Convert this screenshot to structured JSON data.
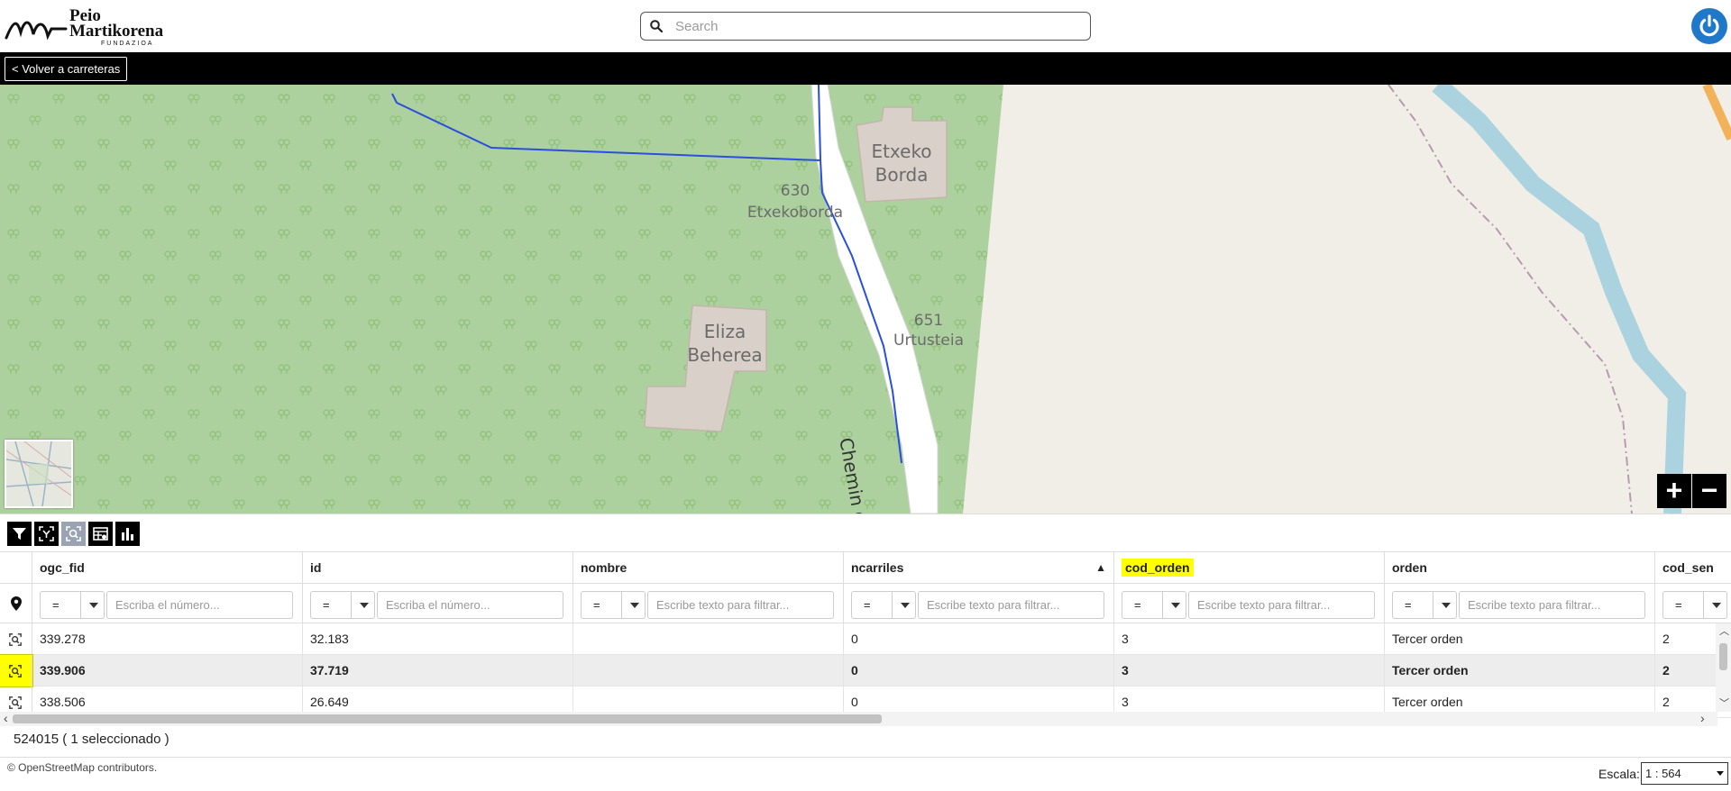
{
  "header": {
    "logo_line1": "Peio",
    "logo_line2": "Martikorena",
    "logo_line3": "FUNDAZIOA",
    "search_placeholder": "Search"
  },
  "topbar": {
    "back_label": "< Volver a carreteras"
  },
  "map": {
    "labels": {
      "etxeko_1": "Etxeko",
      "etxeko_2": "Borda",
      "addr_630_num": "630",
      "addr_630_name": "Etxekoborda",
      "eliza_1": "Eliza",
      "eliza_2": "Beherea",
      "addr_651_num": "651",
      "addr_651_name": "Urtusteia",
      "road_name": "Chemin des ve"
    },
    "zoom_in": "+",
    "zoom_out": "−"
  },
  "toolbar": {
    "buttons": [
      "filter-icon",
      "select-features-icon",
      "zoom-to-selection-icon",
      "table-settings-icon",
      "chart-icon"
    ]
  },
  "table": {
    "columns": [
      "ogc_fid",
      "id",
      "nombre",
      "ncarriles",
      "cod_orden",
      "orden",
      "cod_sen"
    ],
    "sorted_column": "ncarriles",
    "sort_indicator": "▲",
    "highlighted_column": "cod_orden",
    "operator": "=",
    "filter_placeholders": {
      "number": "Escriba el número...",
      "text": "Escribe texto para filtrar..."
    },
    "rows": [
      {
        "ogc_fid": "339.278",
        "id": "32.183",
        "nombre": "",
        "ncarriles": "0",
        "cod_orden": "3",
        "orden": "Tercer orden",
        "cod_sen": "2",
        "selected": false
      },
      {
        "ogc_fid": "339.906",
        "id": "37.719",
        "nombre": "",
        "ncarriles": "0",
        "cod_orden": "3",
        "orden": "Tercer orden",
        "cod_sen": "2",
        "selected": true
      },
      {
        "ogc_fid": "338.506",
        "id": "26.649",
        "nombre": "",
        "ncarriles": "0",
        "cod_orden": "3",
        "orden": "Tercer orden",
        "cod_sen": "2",
        "selected": false
      }
    ],
    "row_count_text": "524015 ( 1 seleccionado )"
  },
  "footer": {
    "attribution": "© OpenStreetMap contributors.",
    "scale_label": "Escala:",
    "scale_value": "1 : 564"
  },
  "colors": {
    "forest": "#add19e",
    "road_line": "#2a4fdc",
    "building": "#d9d0c9",
    "river": "#aad3df",
    "highlight": "#ffff00",
    "power_button": "#1f78c8"
  }
}
